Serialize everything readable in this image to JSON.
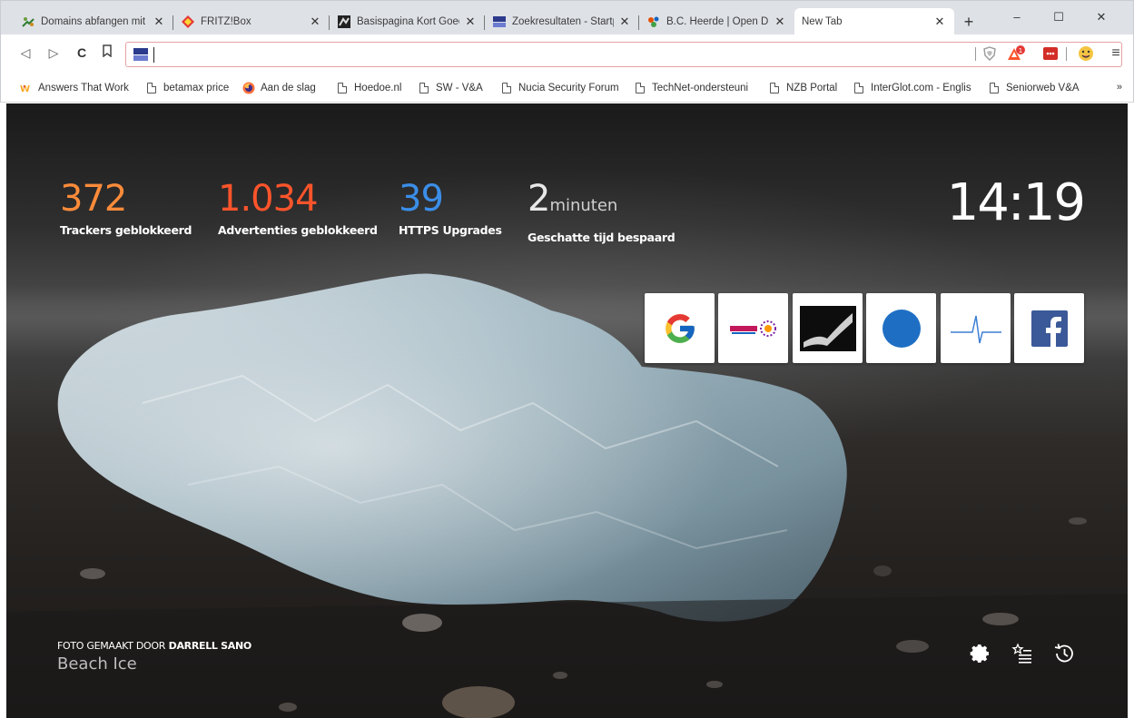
{
  "tabs": [
    {
      "title": "Domains abfangen mit",
      "active": false,
      "favicon": "domains-favicon"
    },
    {
      "title": "FRITZ!Box",
      "active": false,
      "favicon": "fritzbox-favicon"
    },
    {
      "title": "Basispagina Kort Goed",
      "active": false,
      "favicon": "basispagina-favicon"
    },
    {
      "title": "Zoekresultaten - Startp",
      "active": false,
      "favicon": "startpage-favicon"
    },
    {
      "title": "B.C. Heerde | Open Dri",
      "active": false,
      "favicon": "bcheerde-favicon"
    },
    {
      "title": "New Tab",
      "active": true,
      "favicon": ""
    }
  ],
  "window_controls": {
    "minimize": "–",
    "maximize": "☐",
    "close": "✕"
  },
  "toolbar": {
    "back": "◁",
    "forward": "▷",
    "reload": "C",
    "bookmark": "⬚",
    "omnibox_value": "",
    "menu": "≡"
  },
  "bookmarks": [
    {
      "label": "Answers That Work",
      "icon": "atw-favicon"
    },
    {
      "label": "betamax price",
      "icon": "page-icon"
    },
    {
      "label": "Aan de slag",
      "icon": "firefox-icon"
    },
    {
      "label": "Hoedoe.nl",
      "icon": "page-icon"
    },
    {
      "label": "SW - V&A",
      "icon": "page-icon"
    },
    {
      "label": "Nucia Security Forum",
      "icon": "page-icon"
    },
    {
      "label": "TechNet-ondersteuni",
      "icon": "page-icon"
    },
    {
      "label": "NZB Portal",
      "icon": "page-icon"
    },
    {
      "label": "InterGlot.com - Englis",
      "icon": "page-icon"
    },
    {
      "label": "Seniorweb V&A",
      "icon": "page-icon"
    }
  ],
  "bookmarks_more": "»",
  "stats": [
    {
      "value": "372",
      "unit": "",
      "label": "Trackers geblokkeerd",
      "color": "#fb8b3a"
    },
    {
      "value": "1.034",
      "unit": "",
      "label": "Advertenties geblokkeerd",
      "color": "#fb542b"
    },
    {
      "value": "39",
      "unit": "",
      "label": "HTTPS Upgrades",
      "color": "#3b8ee8"
    },
    {
      "value": "2",
      "unit": "minuten",
      "label": "Geschatte tijd bespaard",
      "color": "#e8e8e8"
    }
  ],
  "clock": "14:19",
  "top_sites": [
    "google",
    "computerclub",
    "dark-photo",
    "blue-circle",
    "heartbeat",
    "facebook"
  ],
  "photo_credit": {
    "prefix": "FOTO GEMAAKT DOOR",
    "author": "DARRELL SANO",
    "title": "Beach Ice"
  },
  "bottom_icons": [
    "gear-icon",
    "bookmarks-list-icon",
    "history-icon"
  ]
}
